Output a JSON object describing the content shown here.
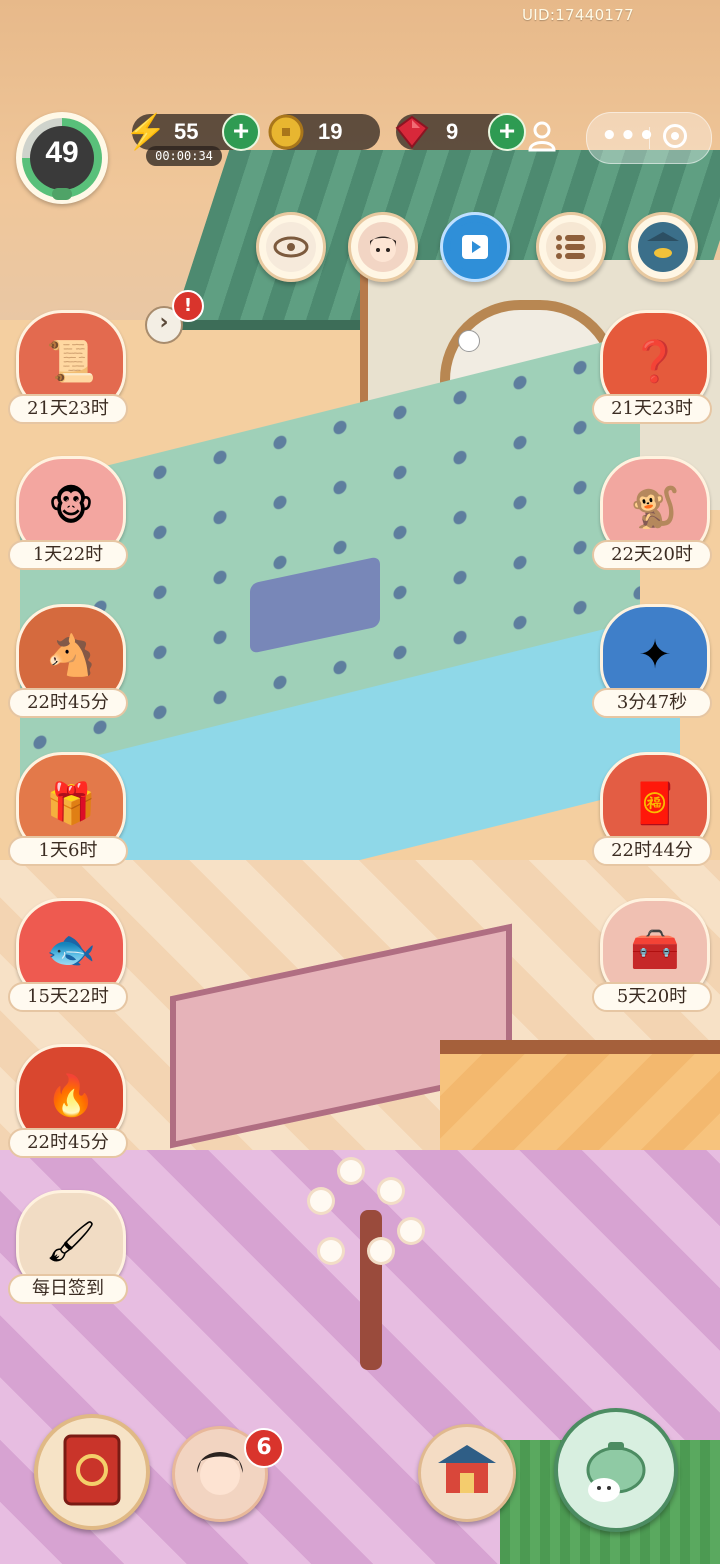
{
  "header": {
    "uid": "UID:17440177"
  },
  "player": {
    "level": "49"
  },
  "resources": {
    "energy": {
      "value": "55",
      "timer": "00:00:34",
      "icon": "lightning-icon"
    },
    "coins": {
      "value": "19",
      "icon": "coin-icon"
    },
    "gems": {
      "value": "9",
      "icon": "ruby-icon"
    }
  },
  "top_buttons": [
    {
      "name": "view-toggle",
      "icon": "eye-icon"
    },
    {
      "name": "character",
      "icon": "girl-avatar-icon"
    },
    {
      "name": "video",
      "icon": "video-play-icon"
    },
    {
      "name": "task-list",
      "icon": "list-icon"
    },
    {
      "name": "shop",
      "icon": "gold-ingot-shrine-icon"
    }
  ],
  "side_alert": "!",
  "events_left": [
    {
      "label": "21天23时",
      "icon": "scroll-book-icon"
    },
    {
      "label": "1天22时",
      "icon": "monkey-tea-icon"
    },
    {
      "label": "22时45分",
      "icon": "horse-lantern-icon"
    },
    {
      "label": "1天6时",
      "icon": "calendar-gift-icon"
    },
    {
      "label": "15天22时",
      "icon": "koi-fish-icon"
    },
    {
      "label": "22时45分",
      "icon": "fire-pearl-icon"
    },
    {
      "label": "每日签到",
      "icon": "brush-painting-icon"
    }
  ],
  "events_right": [
    {
      "label": "21天23时",
      "icon": "mystery-box-icon"
    },
    {
      "label": "22天20时",
      "icon": "monkey-gift-icon"
    },
    {
      "label": "3分47秒",
      "icon": "blue-star-icon"
    },
    {
      "label": "22时44分",
      "icon": "red-gift-chest-icon"
    },
    {
      "label": "5天20时",
      "icon": "treasure-chest-icon"
    }
  ],
  "bottom_bar": {
    "journal_icon": "red-journal-icon",
    "character_icon": "lady-portrait-icon",
    "character_badge": "6",
    "build_icon": "pavilion-icon",
    "tea_icon": "teapot-rabbit-icon"
  },
  "colors": {
    "plus_green": "#2e9b52",
    "alert_red": "#d9342c",
    "label_bg": "#fffaf0"
  }
}
